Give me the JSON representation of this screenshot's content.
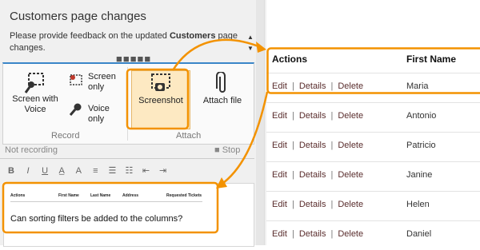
{
  "panel": {
    "title": "Customers page changes",
    "desc_prefix": "Please provide feedback on the updated ",
    "desc_bold": "Customers",
    "desc_suffix": " page changes."
  },
  "ribbon": {
    "screen_with_voice": "Screen with Voice",
    "screen_only": "Screen only",
    "voice_only": "Voice only",
    "screenshot": "Screenshot",
    "attach_file": "Attach file",
    "group_record": "Record",
    "group_attach": "Attach"
  },
  "status": {
    "text": "Not recording",
    "stop": "Stop"
  },
  "format": {
    "bold": "B",
    "italic": "I",
    "underline": "U"
  },
  "editor": {
    "thumb_headers": [
      "Actions",
      "First Name",
      "Last Name",
      "Address",
      "Requested Tickets"
    ],
    "text": "Can sorting filters be added to the columns?"
  },
  "table": {
    "headers": {
      "actions": "Actions",
      "first_name": "First Name"
    },
    "action_labels": {
      "edit": "Edit",
      "details": "Details",
      "delete": "Delete",
      "separator": "|"
    },
    "rows": [
      {
        "name": "Maria"
      },
      {
        "name": "Antonio"
      },
      {
        "name": "Patricio"
      },
      {
        "name": "Janine"
      },
      {
        "name": "Helen"
      },
      {
        "name": "Daniel"
      }
    ]
  },
  "colors": {
    "accent": "#f39200",
    "ribbon_blue": "#3a86c8",
    "link": "#5a2d2d"
  }
}
